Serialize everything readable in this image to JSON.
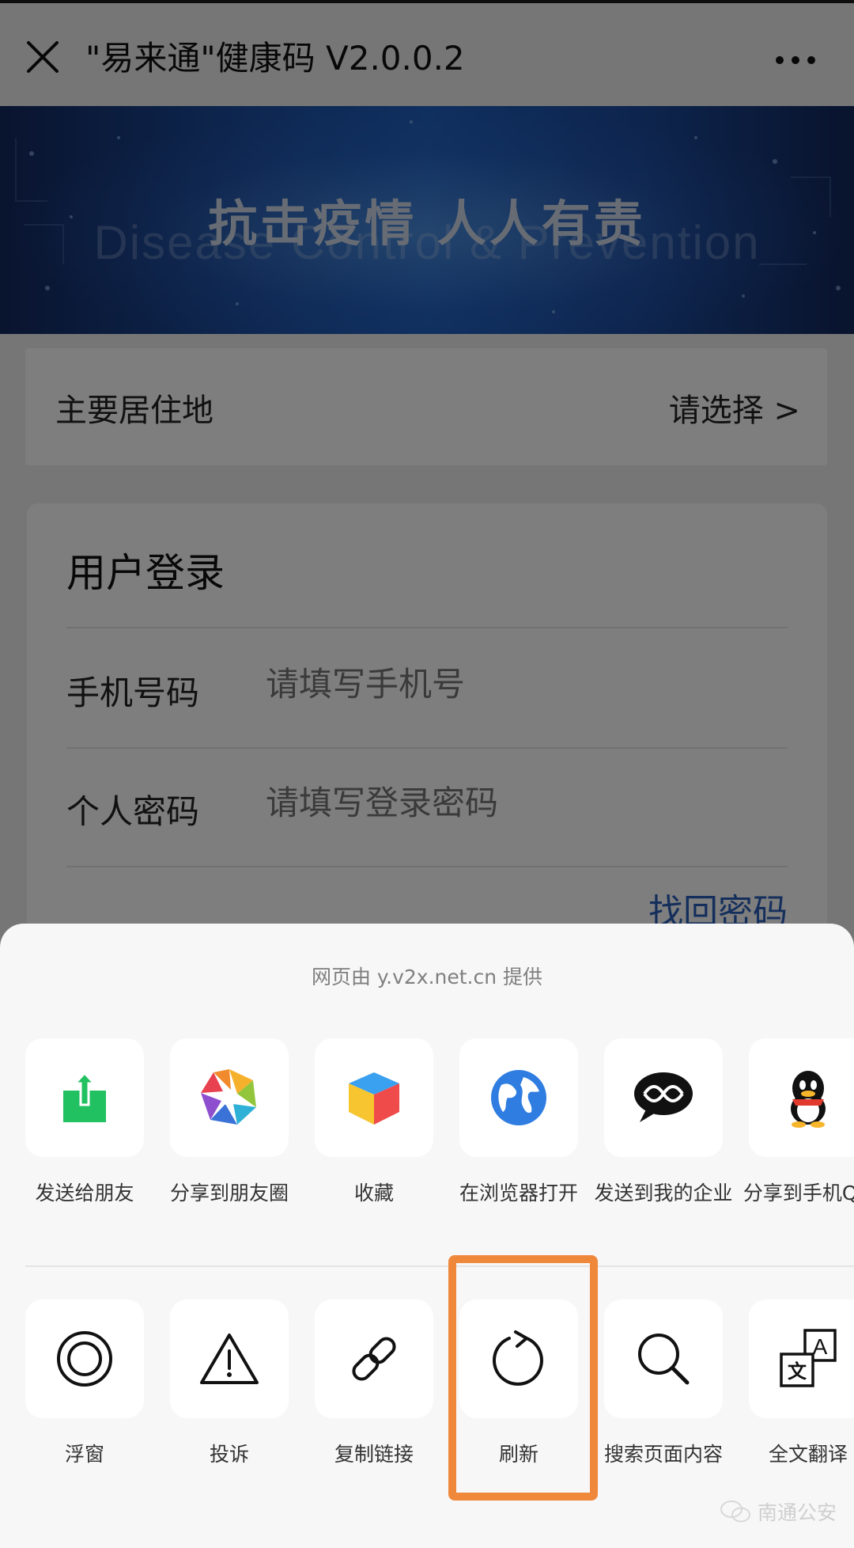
{
  "header": {
    "title": "\"易来通\"健康码 V2.0.0.2",
    "close_icon": "close-icon",
    "more_icon": "more-dots-icon"
  },
  "banner": {
    "slogan": "抗击疫情   人人有责",
    "subtitle": "Disease Control & Prevention"
  },
  "residence": {
    "label": "主要居住地",
    "value": "请选择 >"
  },
  "login": {
    "title": "用户登录",
    "phone_label": "手机号码",
    "phone_placeholder": "请填写手机号",
    "password_label": "个人密码",
    "password_placeholder": "请填写登录密码",
    "forgot": "找回密码"
  },
  "sheet": {
    "provider": "网页由 y.v2x.net.cn 提供",
    "row1": [
      {
        "label": "发送给朋友",
        "icon": "send-to-friend-icon"
      },
      {
        "label": "分享到朋友圈",
        "icon": "moments-icon"
      },
      {
        "label": "收藏",
        "icon": "favorite-cube-icon"
      },
      {
        "label": "在浏览器打开",
        "icon": "browser-globe-icon"
      },
      {
        "label": "发送到我的企业",
        "icon": "wecom-icon"
      },
      {
        "label": "分享到手机QQ",
        "icon": "qq-penguin-icon"
      }
    ],
    "row2": [
      {
        "label": "浮窗",
        "icon": "floating-window-icon"
      },
      {
        "label": "投诉",
        "icon": "warning-triangle-icon"
      },
      {
        "label": "复制链接",
        "icon": "link-icon"
      },
      {
        "label": "刷新",
        "icon": "refresh-icon"
      },
      {
        "label": "搜索页面内容",
        "icon": "search-icon"
      },
      {
        "label": "全文翻译",
        "icon": "translate-icon"
      }
    ]
  },
  "watermark": "南通公安",
  "colors": {
    "highlight": "#f0883c",
    "link": "#2b5fb8",
    "send_green": "#21c161",
    "globe_blue": "#2f7de1"
  }
}
